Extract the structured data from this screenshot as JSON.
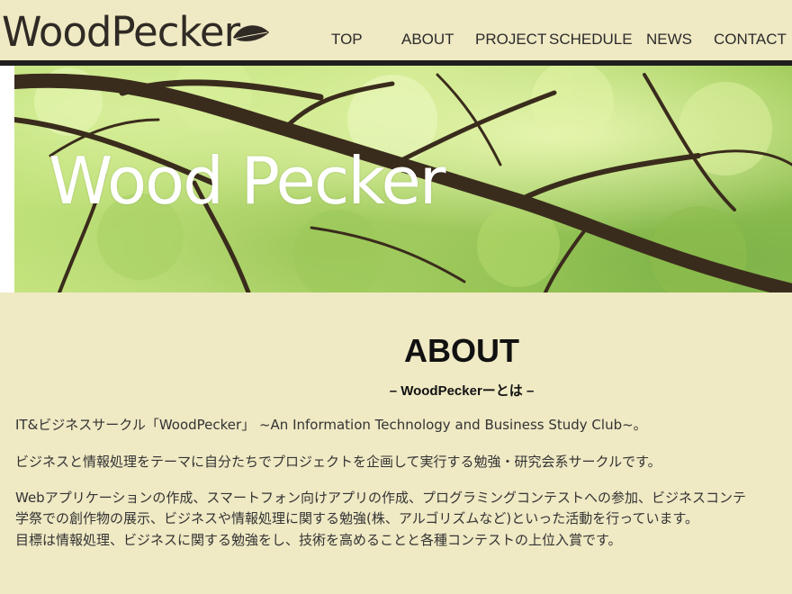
{
  "header": {
    "logo_text": "WoodPecker",
    "nav": [
      {
        "label": "TOP"
      },
      {
        "label": "ABOUT"
      },
      {
        "label": "PROJECT"
      },
      {
        "label": "SCHEDULE"
      },
      {
        "label": "NEWS"
      },
      {
        "label": "CONTACT"
      }
    ]
  },
  "hero": {
    "title": "Wood Pecker"
  },
  "about": {
    "title": "ABOUT",
    "subtitle": "– WoodPeckerーとは –",
    "paragraphs": [
      "IT&ビジネスサークル「WoodPecker」 ~An Information Technology and Business Study Club~。",
      "ビジネスと情報処理をテーマに自分たちでプロジェクトを企画して実行する勉強・研究会系サークルです。",
      "Webアプリケーションの作成、スマートフォン向けアプリの作成、プログラミングコンテストへの参加、ビジネスコンテ",
      "学祭での創作物の展示、ビジネスや情報処理に関する勉強(株、アルゴリズムなど)といった活動を行っています。",
      "目標は情報処理、ビジネスに関する勉強をし、技術を高めることと各種コンテストの上位入賞です。"
    ]
  },
  "colors": {
    "background": "#efe9c4",
    "header_rule": "#1f1f1f",
    "hero_green": "#b7dd6e",
    "text": "#333333"
  },
  "icons": {
    "logo_leaf": "leaf-icon"
  }
}
